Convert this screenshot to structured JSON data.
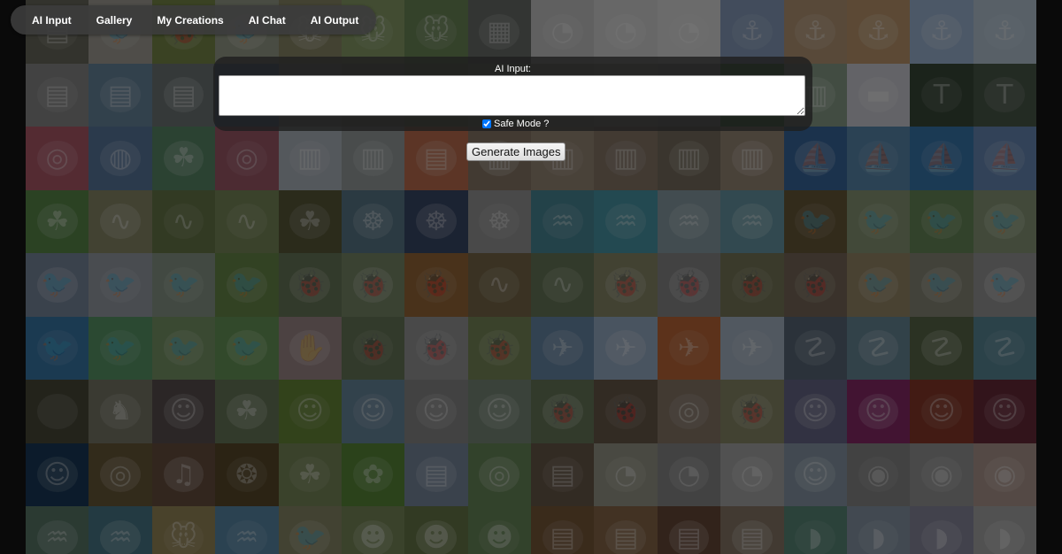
{
  "nav": {
    "items": [
      "AI Input",
      "Gallery",
      "My Creations",
      "AI Chat",
      "AI Output"
    ]
  },
  "input_panel": {
    "label": "AI Input:",
    "prompt_value": "",
    "safe_mode_label": "Safe Mode ?",
    "safe_mode_checked": true,
    "generate_label": "Generate Images"
  },
  "gallery": {
    "columns": 16,
    "rows": 9,
    "tiles": [
      {
        "name": "tile-room",
        "color": "#6b6b5e",
        "icon": "room-icon"
      },
      {
        "name": "tile-crow",
        "color": "#a5a29a",
        "icon": "bird-icon"
      },
      {
        "name": "tile-beetle",
        "color": "#7a8a4a",
        "icon": "bug-icon"
      },
      {
        "name": "tile-crow-2",
        "color": "#9aa08c",
        "icon": "bird-icon"
      },
      {
        "name": "tile-mouse-1",
        "color": "#8c8a6a",
        "icon": "mouse-icon"
      },
      {
        "name": "tile-mouse-2",
        "color": "#8aa06a",
        "icon": "mouse-icon"
      },
      {
        "name": "tile-mouse-3",
        "color": "#6e8a58",
        "icon": "mouse-icon"
      },
      {
        "name": "tile-panel",
        "color": "#6c706c",
        "icon": "panel-icon"
      },
      {
        "name": "tile-gauge-1",
        "color": "#c8c8c8",
        "icon": "gauge-icon"
      },
      {
        "name": "tile-gauge-2",
        "color": "#d8d8d8",
        "icon": "gauge-icon"
      },
      {
        "name": "tile-gauge-3",
        "color": "#e0e0e0",
        "icon": "gauge-icon"
      },
      {
        "name": "tile-oil-1",
        "color": "#8aa0c0",
        "icon": "tower-icon"
      },
      {
        "name": "tile-oil-2",
        "color": "#b89a78",
        "icon": "tower-icon"
      },
      {
        "name": "tile-oil-3",
        "color": "#c09a70",
        "icon": "tower-icon"
      },
      {
        "name": "tile-oil-4",
        "color": "#a0b8d8",
        "icon": "tower-icon"
      },
      {
        "name": "tile-oil-5",
        "color": "#b8c8d8",
        "icon": "tower-icon"
      },
      {
        "name": "tile-lab-1",
        "color": "#8a8a8a",
        "icon": "room-icon"
      },
      {
        "name": "tile-lab-2",
        "color": "#6a88a0",
        "icon": "room-icon"
      },
      {
        "name": "tile-lab-3",
        "color": "#707878",
        "icon": "room-icon"
      },
      {
        "name": "tile-lab-4",
        "color": "#4a6a9a",
        "icon": "room-icon"
      },
      {
        "name": "tile-lab-5",
        "color": "#888",
        "icon": "room-icon"
      },
      {
        "name": "tile-lab-6",
        "color": "#7a7a6a",
        "icon": "room-icon"
      },
      {
        "name": "tile-lab-7",
        "color": "#6a7a5a",
        "icon": "room-icon"
      },
      {
        "name": "tile-lab-8",
        "color": "#7a806a",
        "icon": "room-icon"
      },
      {
        "name": "tile-lab-9",
        "color": "#8a8a80",
        "icon": "room-icon"
      },
      {
        "name": "tile-lab-10",
        "color": "#9a9a90",
        "icon": "room-icon"
      },
      {
        "name": "tile-lab-11",
        "color": "#8a9090",
        "icon": "room-icon"
      },
      {
        "name": "tile-jungle",
        "color": "#3a7a3a",
        "icon": "leaf-icon"
      },
      {
        "name": "tile-door",
        "color": "#8aa08a",
        "icon": "building-icon"
      },
      {
        "name": "tile-car",
        "color": "#d0d0d8",
        "icon": "car-icon"
      },
      {
        "name": "tile-text-1",
        "color": "#3a4a3a",
        "icon": "text-icon"
      },
      {
        "name": "tile-text-2",
        "color": "#4a5a4a",
        "icon": "text-icon"
      },
      {
        "name": "tile-cell",
        "color": "#b05a6a",
        "icon": "circle-icon"
      },
      {
        "name": "tile-map",
        "color": "#5a7aa0",
        "icon": "globe-icon"
      },
      {
        "name": "tile-fern",
        "color": "#5a8a6a",
        "icon": "leaf-icon"
      },
      {
        "name": "tile-eye",
        "color": "#a05a6a",
        "icon": "circle-icon"
      },
      {
        "name": "tile-building-1",
        "color": "#b0b8c0",
        "icon": "building-icon"
      },
      {
        "name": "tile-building-2",
        "color": "#9aa0a0",
        "icon": "building-icon"
      },
      {
        "name": "tile-room-red",
        "color": "#c07050",
        "icon": "room-icon"
      },
      {
        "name": "tile-corridor-1",
        "color": "#8a7a6a",
        "icon": "building-icon"
      },
      {
        "name": "tile-corridor-2",
        "color": "#9a8a78",
        "icon": "building-icon"
      },
      {
        "name": "tile-corridor-3",
        "color": "#8a7a6a",
        "icon": "building-icon"
      },
      {
        "name": "tile-corridor-4",
        "color": "#7a7060",
        "icon": "building-icon"
      },
      {
        "name": "tile-corridor-5",
        "color": "#9a8a78",
        "icon": "building-icon"
      },
      {
        "name": "tile-boat-1",
        "color": "#3a6aa0",
        "icon": "boat-icon"
      },
      {
        "name": "tile-boat-2",
        "color": "#5a8ab0",
        "icon": "boat-icon"
      },
      {
        "name": "tile-boat-3",
        "color": "#3a7ab0",
        "icon": "boat-icon"
      },
      {
        "name": "tile-boat-4",
        "color": "#6a8ab8",
        "icon": "boat-icon"
      },
      {
        "name": "tile-plant",
        "color": "#5a8a4a",
        "icon": "leaf-icon"
      },
      {
        "name": "tile-lizard-1",
        "color": "#8a8a6a",
        "icon": "lizard-icon"
      },
      {
        "name": "tile-lizard-2",
        "color": "#6a7a4a",
        "icon": "lizard-icon"
      },
      {
        "name": "tile-lizard-3",
        "color": "#7a8a5a",
        "icon": "lizard-icon"
      },
      {
        "name": "tile-roots",
        "color": "#5a5a3a",
        "icon": "leaf-icon"
      },
      {
        "name": "tile-robot-1",
        "color": "#5a7a8a",
        "icon": "robot-icon"
      },
      {
        "name": "tile-robot-2",
        "color": "#3a4a6a",
        "icon": "robot-icon"
      },
      {
        "name": "tile-robot-3",
        "color": "#9a9a9a",
        "icon": "robot-icon"
      },
      {
        "name": "tile-fish-1",
        "color": "#4a8a9a",
        "icon": "fish-icon"
      },
      {
        "name": "tile-fish-2",
        "color": "#4a9aaa",
        "icon": "fish-icon"
      },
      {
        "name": "tile-fish-3",
        "color": "#8aa0a8",
        "icon": "fish-icon"
      },
      {
        "name": "tile-fish-4",
        "color": "#6a9aa8",
        "icon": "fish-icon"
      },
      {
        "name": "tile-bird-frame",
        "color": "#6a5a3a",
        "icon": "bird-icon"
      },
      {
        "name": "tile-hawk-1",
        "color": "#8a9a78",
        "icon": "bird-icon"
      },
      {
        "name": "tile-hawk-2",
        "color": "#6a8a5a",
        "icon": "bird-icon"
      },
      {
        "name": "tile-hawk-3",
        "color": "#8a9a7a",
        "icon": "bird-icon"
      },
      {
        "name": "tile-bird-1",
        "color": "#7a8aa0",
        "icon": "bird-icon"
      },
      {
        "name": "tile-bird-2",
        "color": "#9aa0a8",
        "icon": "bird-icon"
      },
      {
        "name": "tile-bird-3",
        "color": "#8a9a8a",
        "icon": "bird-icon"
      },
      {
        "name": "tile-bird-4",
        "color": "#6a8a4a",
        "icon": "bird-icon"
      },
      {
        "name": "tile-insect-1",
        "color": "#6a7a5a",
        "icon": "bug-icon"
      },
      {
        "name": "tile-insect-2",
        "color": "#7a8a6a",
        "icon": "bug-icon"
      },
      {
        "name": "tile-insect-3",
        "color": "#9a6a3a",
        "icon": "bug-icon"
      },
      {
        "name": "tile-lizard-4",
        "color": "#7a6a4a",
        "icon": "lizard-icon"
      },
      {
        "name": "tile-lizard-5",
        "color": "#6a7a5a",
        "icon": "lizard-icon"
      },
      {
        "name": "tile-insect-4",
        "color": "#8a8a6a",
        "icon": "bug-icon"
      },
      {
        "name": "tile-insect-5",
        "color": "#8a8a8a",
        "icon": "bug-icon"
      },
      {
        "name": "tile-insect-6",
        "color": "#7a7a5a",
        "icon": "bug-icon"
      },
      {
        "name": "tile-insect-7",
        "color": "#7a6a5a",
        "icon": "bug-icon"
      },
      {
        "name": "tile-bird-5",
        "color": "#9a8a6a",
        "icon": "bird-icon"
      },
      {
        "name": "tile-bird-6",
        "color": "#8a8a7a",
        "icon": "bird-icon"
      },
      {
        "name": "tile-bird-7",
        "color": "#9a9a9a",
        "icon": "bird-icon"
      },
      {
        "name": "tile-blue-bird-1",
        "color": "#3a7aaa",
        "icon": "bird-icon"
      },
      {
        "name": "tile-blue-bird-2",
        "color": "#5a9a6a",
        "icon": "bird-icon"
      },
      {
        "name": "tile-blue-bird-3",
        "color": "#7a9a6a",
        "icon": "bird-icon"
      },
      {
        "name": "tile-blue-bird-4",
        "color": "#6a9a5a",
        "icon": "bird-icon"
      },
      {
        "name": "tile-hand",
        "color": "#a08a8a",
        "icon": "hand-icon"
      },
      {
        "name": "tile-bug-red",
        "color": "#6a7a5a",
        "icon": "bug-icon"
      },
      {
        "name": "tile-spider",
        "color": "#9a9a9a",
        "icon": "bug-icon"
      },
      {
        "name": "tile-bug-pink",
        "color": "#7a8a5a",
        "icon": "bug-icon"
      },
      {
        "name": "tile-plane-1",
        "color": "#6a8aaa",
        "icon": "plane-icon"
      },
      {
        "name": "tile-plane-2",
        "color": "#9ab0c8",
        "icon": "plane-icon"
      },
      {
        "name": "tile-plane-3",
        "color": "#c06a3a",
        "icon": "plane-icon"
      },
      {
        "name": "tile-plane-4",
        "color": "#aab8c8",
        "icon": "plane-icon"
      },
      {
        "name": "tile-dragon-1",
        "color": "#5a6a7a",
        "icon": "dragon-icon"
      },
      {
        "name": "tile-dragon-2",
        "color": "#6a8a9a",
        "icon": "dragon-icon"
      },
      {
        "name": "tile-dragon-3",
        "color": "#5a6a4a",
        "icon": "dragon-icon"
      },
      {
        "name": "tile-dragon-4",
        "color": "#5a8a9a",
        "icon": "dragon-icon"
      },
      {
        "name": "tile-dark",
        "color": "#4a4a3a",
        "icon": "blank-icon"
      },
      {
        "name": "tile-horse",
        "color": "#7a7a6a",
        "icon": "horse-icon"
      },
      {
        "name": "tile-anime-1",
        "color": "#5a5050",
        "icon": "face-icon"
      },
      {
        "name": "tile-field",
        "color": "#6a7a5a",
        "icon": "leaf-icon"
      },
      {
        "name": "tile-dancer",
        "color": "#6a8a3a",
        "icon": "person-icon"
      },
      {
        "name": "tile-baseball-1",
        "color": "#6a8aa0",
        "icon": "person-icon"
      },
      {
        "name": "tile-baseball-2",
        "color": "#8a8a8a",
        "icon": "person-icon"
      },
      {
        "name": "tile-baseball-3",
        "color": "#7a8a7a",
        "icon": "person-icon"
      },
      {
        "name": "tile-spider-2",
        "color": "#6a7a5a",
        "icon": "bug-icon"
      },
      {
        "name": "tile-spider-3",
        "color": "#6a5a4a",
        "icon": "bug-icon"
      },
      {
        "name": "tile-shell",
        "color": "#8a7a6a",
        "icon": "circle-icon"
      },
      {
        "name": "tile-beetle-2",
        "color": "#8a8a6a",
        "icon": "bug-icon"
      },
      {
        "name": "tile-anime-2",
        "color": "#6a6a8a",
        "icon": "face-icon"
      },
      {
        "name": "tile-anime-3",
        "color": "#8a2a6a",
        "icon": "face-icon"
      },
      {
        "name": "tile-anime-4",
        "color": "#8a3a2a",
        "icon": "face-icon"
      },
      {
        "name": "tile-anime-5",
        "color": "#6a2a3a",
        "icon": "face-icon"
      },
      {
        "name": "tile-demon",
        "color": "#1a3a5a",
        "icon": "face-icon"
      },
      {
        "name": "tile-brass",
        "color": "#6a5a3a",
        "icon": "circle-icon"
      },
      {
        "name": "tile-piano",
        "color": "#6a5040",
        "icon": "piano-icon"
      },
      {
        "name": "tile-lamp",
        "color": "#5a4a2a",
        "icon": "lamp-icon"
      },
      {
        "name": "tile-fruit",
        "color": "#7a8a5a",
        "icon": "leaf-icon"
      },
      {
        "name": "tile-flower",
        "color": "#5a8a3a",
        "icon": "flower-icon"
      },
      {
        "name": "tile-book",
        "color": "#7a8aa0",
        "icon": "book-icon"
      },
      {
        "name": "tile-shield",
        "color": "#6a8a5a",
        "icon": "circle-icon"
      },
      {
        "name": "tile-menu",
        "color": "#6a5a4a",
        "icon": "book-icon"
      },
      {
        "name": "tile-clock",
        "color": "#9a9a8a",
        "icon": "gauge-icon"
      },
      {
        "name": "tile-gauge-4",
        "color": "#8a8a8a",
        "icon": "gauge-icon"
      },
      {
        "name": "tile-gauge-5",
        "color": "#aaaaaa",
        "icon": "gauge-icon"
      },
      {
        "name": "tile-anime-6",
        "color": "#8a9aaa",
        "icon": "face-icon"
      },
      {
        "name": "tile-eye-1",
        "color": "#8a8a8a",
        "icon": "eye-icon"
      },
      {
        "name": "tile-eye-2",
        "color": "#9a9a9a",
        "icon": "eye-icon"
      },
      {
        "name": "tile-eye-3",
        "color": "#b09a90",
        "icon": "eye-icon"
      },
      {
        "name": "tile-reef-1",
        "color": "#5a7a6a",
        "icon": "fish-icon"
      },
      {
        "name": "tile-reef-2",
        "color": "#4a7a8a",
        "icon": "fish-icon"
      },
      {
        "name": "tile-rodent",
        "color": "#9a8a5a",
        "icon": "mouse-icon"
      },
      {
        "name": "tile-fish-5",
        "color": "#5a8aaa",
        "icon": "fish-icon"
      },
      {
        "name": "tile-bird-8",
        "color": "#8a8a6a",
        "icon": "bird-icon"
      },
      {
        "name": "tile-monkey-1",
        "color": "#7a8a5a",
        "icon": "monkey-icon"
      },
      {
        "name": "tile-monkey-2",
        "color": "#6a7a4a",
        "icon": "monkey-icon"
      },
      {
        "name": "tile-monkey-3",
        "color": "#6a8a5a",
        "icon": "monkey-icon"
      },
      {
        "name": "tile-restaurant-1",
        "color": "#7a5a3a",
        "icon": "room-icon"
      },
      {
        "name": "tile-restaurant-2",
        "color": "#8a6a4a",
        "icon": "room-icon"
      },
      {
        "name": "tile-restaurant-3",
        "color": "#6a4a3a",
        "icon": "room-icon"
      },
      {
        "name": "tile-restaurant-4",
        "color": "#8a7a6a",
        "icon": "room-icon"
      },
      {
        "name": "tile-elephant-1",
        "color": "#5a8a7a",
        "icon": "elephant-icon"
      },
      {
        "name": "tile-elephant-2",
        "color": "#8a9aaa",
        "icon": "elephant-icon"
      },
      {
        "name": "tile-elephant-3",
        "color": "#8a8aa0",
        "icon": "elephant-icon"
      },
      {
        "name": "tile-elephant-4",
        "color": "#aaaaaa",
        "icon": "elephant-icon"
      }
    ]
  }
}
